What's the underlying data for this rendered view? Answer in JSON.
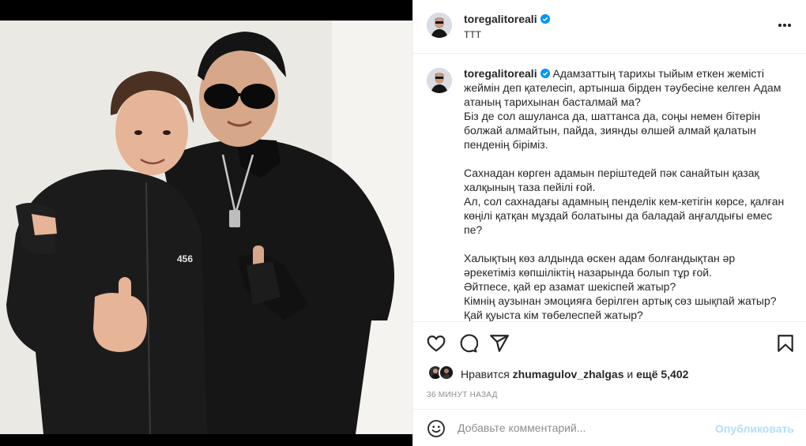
{
  "post": {
    "username": "toregalitoreali",
    "location": "TTT",
    "verified": true
  },
  "caption": {
    "username": "toregalitoreali",
    "text": "Адамзаттың тарихы тыйым еткен жемісті жеймін деп қателесіп, артынша бірден тәубесіне келген Адам атаның тарихынан басталмай ма?\nБіз де сол ашуланса да, шаттанса да, соңы немен бітерін болжай алмайтын, пайда, зиянды өлшей алмай қалатын пенденің біріміз.\n\nСахнадан көрген адамын періштедей пәк санайтын қазақ халқының таза пейілі ғой.\nАл, сол сахнадағы адамның пенделік кем-кетігін көрсе, қалған көңілі қатқан мұздай болатыны да баладай аңғалдығы емес пе?\n\nХалықтың көз алдында өскен адам болғандықтан әр әрекетіміз көпшіліктің назарында болып тұр ғой.\nӘйтпесе, қай ер азамат шекіспей жатыр?\nКімнің аузынан эмоцияға берілген артық сөз шықпай жатыр?\nҚай қуыста кім төбелеспей жатыр?"
  },
  "photo": {
    "print_text": "456"
  },
  "likes": {
    "prefix": "Нравится",
    "liker": "zhumagulov_zhalgas",
    "connector": "и",
    "others": "ещё 5,402"
  },
  "timestamp": "36 МИНУТ НАЗАД",
  "comment_box": {
    "placeholder": "Добавьте комментарий...",
    "publish_label": "Опубликовать"
  },
  "icons": {
    "like": "heart-icon",
    "comment": "comment-bubble-icon",
    "share": "paper-plane-icon",
    "save": "bookmark-icon",
    "emoji": "emoji-smile-icon",
    "more": "more-options-icon",
    "verified": "verified-badge-icon"
  },
  "colors": {
    "verified": "#0095f6",
    "publish_disabled": "#b2dffc",
    "muted_text": "#8e8e8e",
    "divider": "#efefef"
  }
}
